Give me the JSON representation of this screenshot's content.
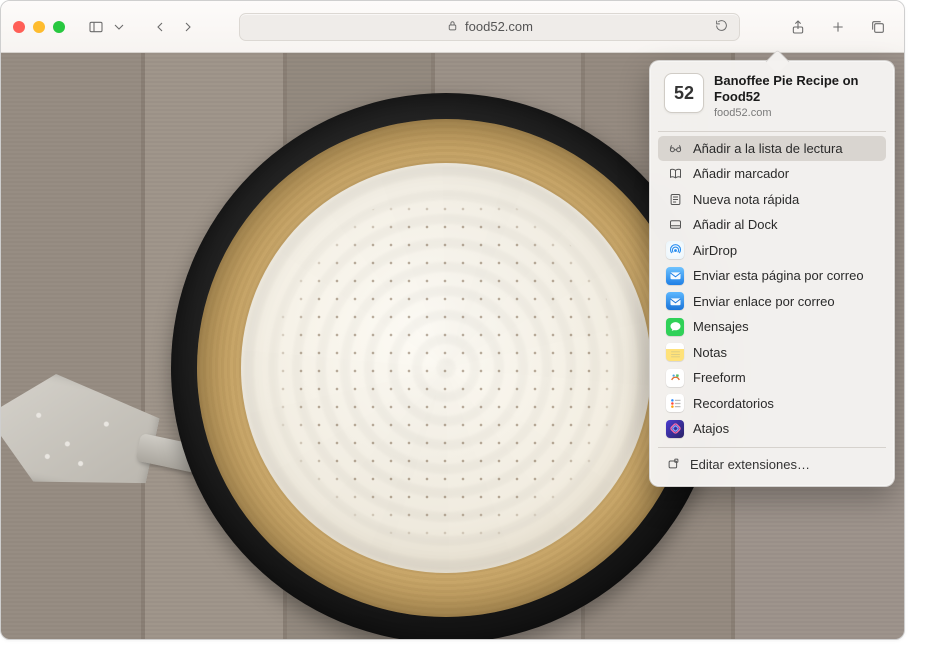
{
  "address_bar": {
    "domain": "food52.com"
  },
  "share_popover": {
    "thumb_text": "52",
    "title": "Banoffee Pie Recipe on Food52",
    "subtitle": "food52.com",
    "items": [
      {
        "label": "Añadir a la lista de lectura",
        "highlight": true
      },
      {
        "label": "Añadir marcador"
      },
      {
        "label": "Nueva nota rápida"
      },
      {
        "label": "Añadir al Dock"
      },
      {
        "label": "AirDrop"
      },
      {
        "label": "Enviar esta página por correo"
      },
      {
        "label": "Enviar enlace por correo"
      },
      {
        "label": "Mensajes"
      },
      {
        "label": "Notas"
      },
      {
        "label": "Freeform"
      },
      {
        "label": "Recordatorios"
      },
      {
        "label": "Atajos"
      }
    ],
    "footer": "Editar extensiones…"
  }
}
